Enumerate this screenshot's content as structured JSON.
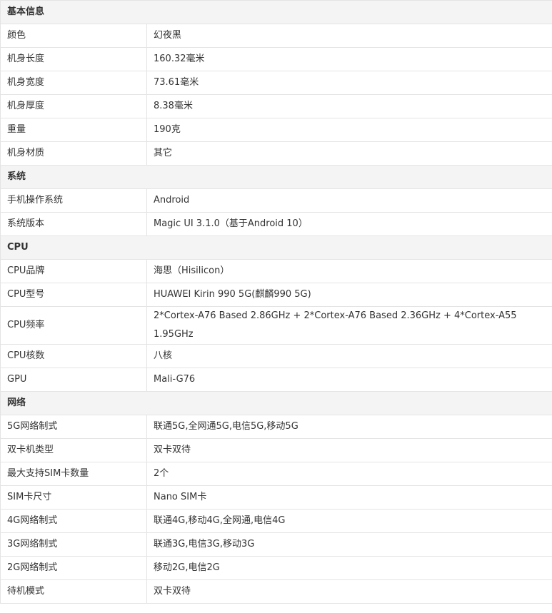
{
  "sections": [
    {
      "title": "基本信息",
      "rows": [
        {
          "label": "颜色",
          "value": "幻夜黑"
        },
        {
          "label": "机身长度",
          "value": "160.32毫米"
        },
        {
          "label": "机身宽度",
          "value": "73.61毫米"
        },
        {
          "label": "机身厚度",
          "value": "8.38毫米"
        },
        {
          "label": "重量",
          "value": "190克"
        },
        {
          "label": "机身材质",
          "value": "其它"
        }
      ]
    },
    {
      "title": "系统",
      "rows": [
        {
          "label": "手机操作系统",
          "value": "Android"
        },
        {
          "label": "系统版本",
          "value": "Magic UI 3.1.0（基于Android 10）"
        }
      ]
    },
    {
      "title": "CPU",
      "rows": [
        {
          "label": "CPU品牌",
          "value": "海思（Hisilicon）"
        },
        {
          "label": "CPU型号",
          "value": "HUAWEI Kirin 990 5G(麒麟990 5G)"
        },
        {
          "label": "CPU频率",
          "value": "2*Cortex-A76 Based 2.86GHz + 2*Cortex-A76 Based 2.36GHz + 4*Cortex-A55 1.95GHz"
        },
        {
          "label": "CPU核数",
          "value": "八核"
        },
        {
          "label": "GPU",
          "value": "Mali-G76"
        }
      ]
    },
    {
      "title": "网络",
      "rows": [
        {
          "label": "5G网络制式",
          "value": "联通5G,全网通5G,电信5G,移动5G"
        },
        {
          "label": "双卡机类型",
          "value": "双卡双待"
        },
        {
          "label": "最大支持SIM卡数量",
          "value": "2个"
        },
        {
          "label": "SIM卡尺寸",
          "value": "Nano SIM卡"
        },
        {
          "label": "4G网络制式",
          "value": "联通4G,移动4G,全网通,电信4G"
        },
        {
          "label": "3G网络制式",
          "value": "联通3G,电信3G,移动3G"
        },
        {
          "label": "2G网络制式",
          "value": "移动2G,电信2G"
        },
        {
          "label": "待机模式",
          "value": "双卡双待"
        }
      ]
    }
  ]
}
